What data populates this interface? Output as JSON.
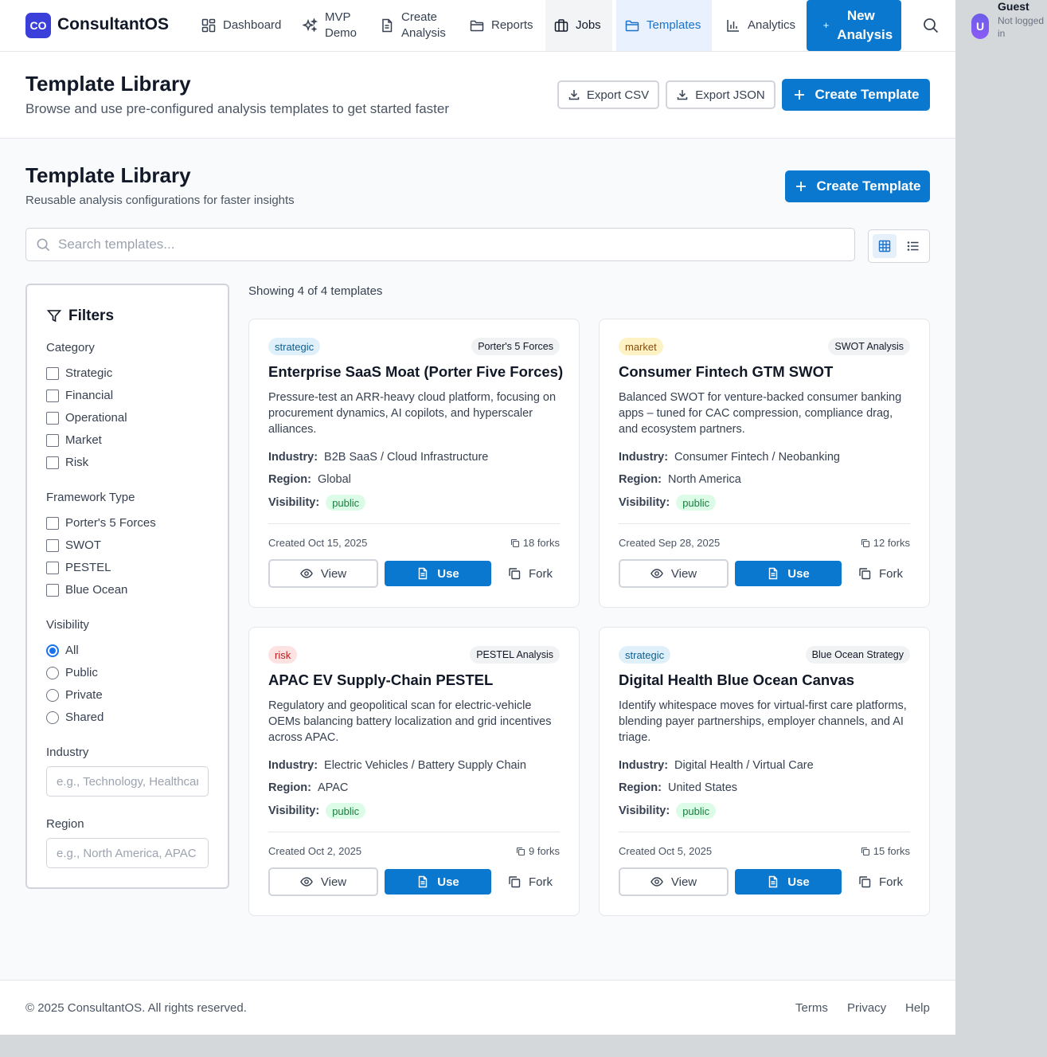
{
  "brand": {
    "logo_initials": "CO",
    "name": "ConsultantOS"
  },
  "nav": {
    "items": [
      {
        "label": "Dashboard",
        "icon": "dashboard-icon"
      },
      {
        "label": "MVP Demo",
        "icon": "sparkles-icon"
      },
      {
        "label": "Create Analysis",
        "icon": "document-icon"
      },
      {
        "label": "Reports",
        "icon": "folder-icon"
      },
      {
        "label": "Jobs",
        "icon": "briefcase-icon"
      },
      {
        "label": "Templates",
        "icon": "folder-icon"
      },
      {
        "label": "Analytics",
        "icon": "bar-chart-icon"
      }
    ],
    "new_analysis_plus": "+",
    "new_analysis_label": "New Analysis",
    "active_item": "Templates"
  },
  "user": {
    "avatar_initial": "U",
    "name": "Guest",
    "status": "Not logged in"
  },
  "page_header": {
    "title": "Template Library",
    "subtitle": "Browse and use pre-configured analysis templates to get started faster",
    "export_csv": "Export CSV",
    "export_json": "Export JSON",
    "create_template": "Create Template"
  },
  "library": {
    "title": "Template Library",
    "subtitle": "Reusable analysis configurations for faster insights",
    "create_template": "Create Template",
    "search_placeholder": "Search templates...",
    "search_value": "",
    "view_mode": "grid"
  },
  "filters": {
    "title": "Filters",
    "category_label": "Category",
    "categories": [
      "Strategic",
      "Financial",
      "Operational",
      "Market",
      "Risk"
    ],
    "framework_label": "Framework Type",
    "frameworks": [
      "Porter's 5 Forces",
      "SWOT",
      "PESTEL",
      "Blue Ocean"
    ],
    "visibility_label": "Visibility",
    "visibility_options": [
      "All",
      "Public",
      "Private",
      "Shared"
    ],
    "visibility_selected": "All",
    "industry_label": "Industry",
    "industry_placeholder": "e.g., Technology, Healthcare",
    "region_label": "Region",
    "region_placeholder": "e.g., North America, APAC"
  },
  "results": {
    "showing_text": "Showing 4 of 4 templates"
  },
  "labels": {
    "industry": "Industry:",
    "region": "Region:",
    "visibility": "Visibility:",
    "view": "View",
    "use": "Use",
    "fork": "Fork"
  },
  "templates": [
    {
      "category": "strategic",
      "framework": "Porter's 5 Forces",
      "title": "Enterprise SaaS Moat (Porter Five Forces)",
      "description": "Pressure-test an ARR-heavy cloud platform, focusing on procurement dynamics, AI copilots, and hyperscaler alliances.",
      "industry": "B2B SaaS / Cloud Infrastructure",
      "region": "Global",
      "visibility": "public",
      "created": "Created Oct 15, 2025",
      "forks": "18 forks"
    },
    {
      "category": "market",
      "framework": "SWOT Analysis",
      "title": "Consumer Fintech GTM SWOT",
      "description": "Balanced SWOT for venture-backed consumer banking apps – tuned for CAC compression, compliance drag, and ecosystem partners.",
      "industry": "Consumer Fintech / Neobanking",
      "region": "North America",
      "visibility": "public",
      "created": "Created Sep 28, 2025",
      "forks": "12 forks"
    },
    {
      "category": "risk",
      "framework": "PESTEL Analysis",
      "title": "APAC EV Supply-Chain PESTEL",
      "description": "Regulatory and geopolitical scan for electric-vehicle OEMs balancing battery localization and grid incentives across APAC.",
      "industry": "Electric Vehicles / Battery Supply Chain",
      "region": "APAC",
      "visibility": "public",
      "created": "Created Oct 2, 2025",
      "forks": "9 forks"
    },
    {
      "category": "strategic",
      "framework": "Blue Ocean Strategy",
      "title": "Digital Health Blue Ocean Canvas",
      "description": "Identify whitespace moves for virtual-first care platforms, blending payer partnerships, employer channels, and AI triage.",
      "industry": "Digital Health / Virtual Care",
      "region": "United States",
      "visibility": "public",
      "created": "Created Oct 5, 2025",
      "forks": "15 forks"
    }
  ],
  "footer": {
    "copyright": "© 2025 ConsultantOS. All rights reserved.",
    "links": [
      "Terms",
      "Privacy",
      "Help"
    ]
  },
  "colors": {
    "primary": "#0b78cf",
    "brand": "#3b3fd9",
    "public_badge": "#dcfce7"
  }
}
